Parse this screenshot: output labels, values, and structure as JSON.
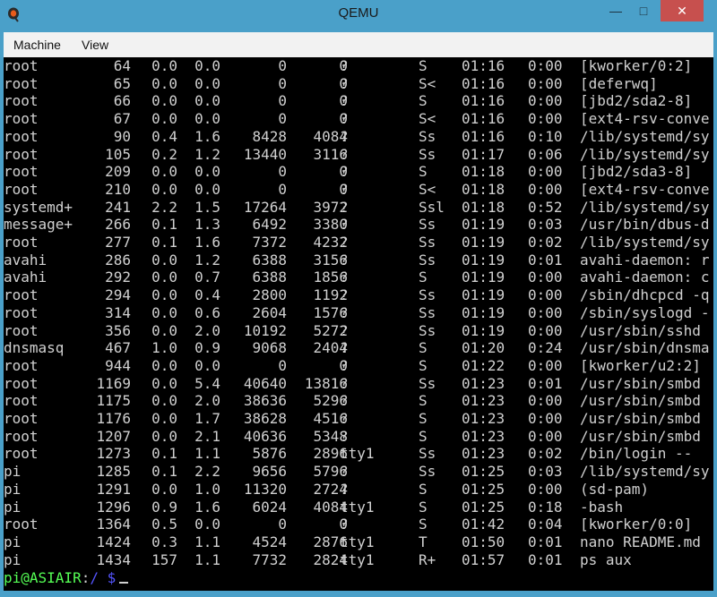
{
  "window": {
    "title": "QEMU"
  },
  "window_controls": {
    "minimize": "—",
    "maximize": "□",
    "close": "✕"
  },
  "menu": [
    "Machine",
    "View"
  ],
  "colors": {
    "frame": "#4aa0c9",
    "close": "#c7504e",
    "terminal_bg": "#000000",
    "text": "#d0d0d0",
    "prompt_user": "#55ff55",
    "prompt_path": "#5555ff"
  },
  "processes": [
    [
      "root",
      "64",
      "0.0",
      "0.0",
      "0",
      "0",
      "?",
      "S",
      "01:16",
      "0:00",
      "[kworker/0:2]"
    ],
    [
      "root",
      "65",
      "0.0",
      "0.0",
      "0",
      "0",
      "?",
      "S<",
      "01:16",
      "0:00",
      "[deferwq]"
    ],
    [
      "root",
      "66",
      "0.0",
      "0.0",
      "0",
      "0",
      "?",
      "S",
      "01:16",
      "0:00",
      "[jbd2/sda2-8]"
    ],
    [
      "root",
      "67",
      "0.0",
      "0.0",
      "0",
      "0",
      "?",
      "S<",
      "01:16",
      "0:00",
      "[ext4-rsv-conve"
    ],
    [
      "root",
      "90",
      "0.4",
      "1.6",
      "8428",
      "4084",
      "?",
      "Ss",
      "01:16",
      "0:10",
      "/lib/systemd/sy"
    ],
    [
      "root",
      "105",
      "0.2",
      "1.2",
      "13440",
      "3116",
      "?",
      "Ss",
      "01:17",
      "0:06",
      "/lib/systemd/sy"
    ],
    [
      "root",
      "209",
      "0.0",
      "0.0",
      "0",
      "0",
      "?",
      "S",
      "01:18",
      "0:00",
      "[jbd2/sda3-8]"
    ],
    [
      "root",
      "210",
      "0.0",
      "0.0",
      "0",
      "0",
      "?",
      "S<",
      "01:18",
      "0:00",
      "[ext4-rsv-conve"
    ],
    [
      "systemd+",
      "241",
      "2.2",
      "1.5",
      "17264",
      "3972",
      "?",
      "Ssl",
      "01:18",
      "0:52",
      "/lib/systemd/sy"
    ],
    [
      "message+",
      "266",
      "0.1",
      "1.3",
      "6492",
      "3380",
      "?",
      "Ss",
      "01:19",
      "0:03",
      "/usr/bin/dbus-d"
    ],
    [
      "root",
      "277",
      "0.1",
      "1.6",
      "7372",
      "4232",
      "?",
      "Ss",
      "01:19",
      "0:02",
      "/lib/systemd/sy"
    ],
    [
      "avahi",
      "286",
      "0.0",
      "1.2",
      "6388",
      "3156",
      "?",
      "Ss",
      "01:19",
      "0:01",
      "avahi-daemon: r"
    ],
    [
      "avahi",
      "292",
      "0.0",
      "0.7",
      "6388",
      "1856",
      "?",
      "S",
      "01:19",
      "0:00",
      "avahi-daemon: c"
    ],
    [
      "root",
      "294",
      "0.0",
      "0.4",
      "2800",
      "1192",
      "?",
      "Ss",
      "01:19",
      "0:00",
      "/sbin/dhcpcd -q"
    ],
    [
      "root",
      "314",
      "0.0",
      "0.6",
      "2604",
      "1576",
      "?",
      "Ss",
      "01:19",
      "0:00",
      "/sbin/syslogd -"
    ],
    [
      "root",
      "356",
      "0.0",
      "2.0",
      "10192",
      "5272",
      "?",
      "Ss",
      "01:19",
      "0:00",
      "/usr/sbin/sshd"
    ],
    [
      "dnsmasq",
      "467",
      "1.0",
      "0.9",
      "9068",
      "2404",
      "?",
      "S",
      "01:20",
      "0:24",
      "/usr/sbin/dnsma"
    ],
    [
      "root",
      "944",
      "0.0",
      "0.0",
      "0",
      "0",
      "?",
      "S",
      "01:22",
      "0:00",
      "[kworker/u2:2]"
    ],
    [
      "root",
      "1169",
      "0.0",
      "5.4",
      "40640",
      "13816",
      "?",
      "Ss",
      "01:23",
      "0:01",
      "/usr/sbin/smbd"
    ],
    [
      "root",
      "1175",
      "0.0",
      "2.0",
      "38636",
      "5296",
      "?",
      "S",
      "01:23",
      "0:00",
      "/usr/sbin/smbd"
    ],
    [
      "root",
      "1176",
      "0.0",
      "1.7",
      "38628",
      "4516",
      "?",
      "S",
      "01:23",
      "0:00",
      "/usr/sbin/smbd"
    ],
    [
      "root",
      "1207",
      "0.0",
      "2.1",
      "40636",
      "5348",
      "?",
      "S",
      "01:23",
      "0:00",
      "/usr/sbin/smbd"
    ],
    [
      "root",
      "1273",
      "0.1",
      "1.1",
      "5876",
      "2896",
      "tty1",
      "Ss",
      "01:23",
      "0:02",
      "/bin/login --"
    ],
    [
      "pi",
      "1285",
      "0.1",
      "2.2",
      "9656",
      "5796",
      "?",
      "Ss",
      "01:25",
      "0:03",
      "/lib/systemd/sy"
    ],
    [
      "pi",
      "1291",
      "0.0",
      "1.0",
      "11320",
      "2724",
      "?",
      "S",
      "01:25",
      "0:00",
      "(sd-pam)"
    ],
    [
      "pi",
      "1296",
      "0.9",
      "1.6",
      "6024",
      "4084",
      "tty1",
      "S",
      "01:25",
      "0:18",
      "-bash"
    ],
    [
      "root",
      "1364",
      "0.5",
      "0.0",
      "0",
      "0",
      "?",
      "S",
      "01:42",
      "0:04",
      "[kworker/0:0]"
    ],
    [
      "pi",
      "1424",
      "0.3",
      "1.1",
      "4524",
      "2876",
      "tty1",
      "T",
      "01:50",
      "0:01",
      "nano README.md"
    ],
    [
      "pi",
      "1434",
      "157",
      "1.1",
      "7732",
      "2824",
      "tty1",
      "R+",
      "01:57",
      "0:01",
      "ps aux"
    ]
  ],
  "prompt": {
    "user_host": "pi@ASIAIR",
    "colon": ":",
    "path": "/",
    "symbol": " $"
  }
}
